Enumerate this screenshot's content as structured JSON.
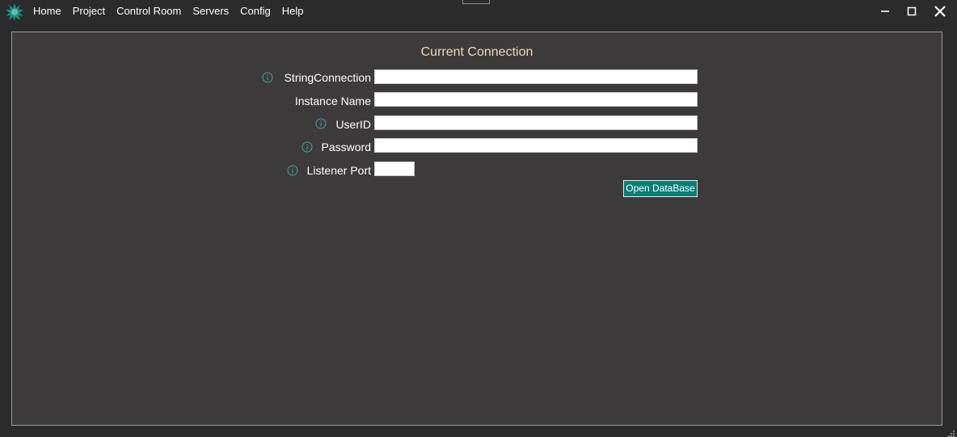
{
  "menu": {
    "items": [
      "Home",
      "Project",
      "Control Room",
      "Servers",
      "Config",
      "Help"
    ]
  },
  "window_controls": {
    "minimize": "minimize-icon",
    "maximize": "maximize-icon",
    "close": "close-icon"
  },
  "panel": {
    "title": "Current Connection",
    "fields": {
      "string_connection": {
        "label": "StringConnection",
        "value": "",
        "has_info": true
      },
      "instance_name": {
        "label": "Instance Name",
        "value": "",
        "has_info": false
      },
      "user_id": {
        "label": "UserID",
        "value": "",
        "has_info": true
      },
      "password": {
        "label": "Password",
        "value": "",
        "has_info": true
      },
      "listener_port": {
        "label": "Listener Port",
        "value": "",
        "has_info": true
      }
    },
    "open_button_label": "Open DataBase"
  },
  "colors": {
    "accent": "#0a7f77",
    "title_text": "#f0d9b5",
    "info_icon": "#4aa3a0",
    "panel_bg": "#3c3a3b",
    "window_bg": "#2b2b2b"
  }
}
